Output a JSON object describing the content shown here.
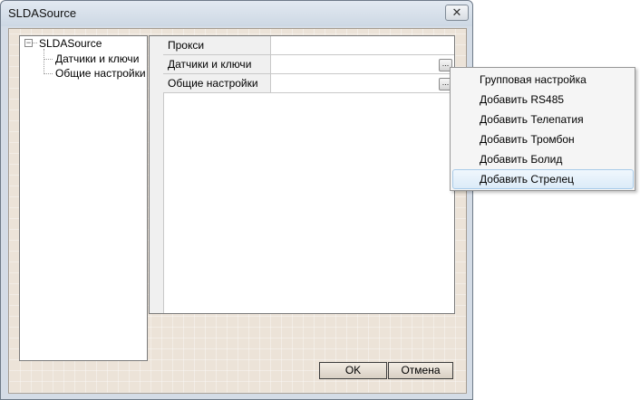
{
  "window": {
    "title": "SLDASource",
    "close_glyph": "✕"
  },
  "tree": {
    "toggle_glyph": "−",
    "root": "SLDASource",
    "children": [
      "Датчики и ключи",
      "Общие настройки"
    ]
  },
  "properties": {
    "rows": [
      {
        "name": "Прокси",
        "value": "",
        "has_button": false
      },
      {
        "name": "Датчики и ключи",
        "value": "",
        "has_button": true
      },
      {
        "name": "Общие настройки",
        "value": "",
        "has_button": true
      }
    ],
    "ellipsis_glyph": "..."
  },
  "buttons": {
    "ok": "OK",
    "cancel": "Отмена"
  },
  "menu": {
    "items": [
      "Групповая настройка",
      "Добавить RS485",
      "Добавить Телепатия",
      "Добавить Тромбон",
      "Добавить Болид",
      "Добавить Стрелец"
    ],
    "highlighted_index": 5
  }
}
